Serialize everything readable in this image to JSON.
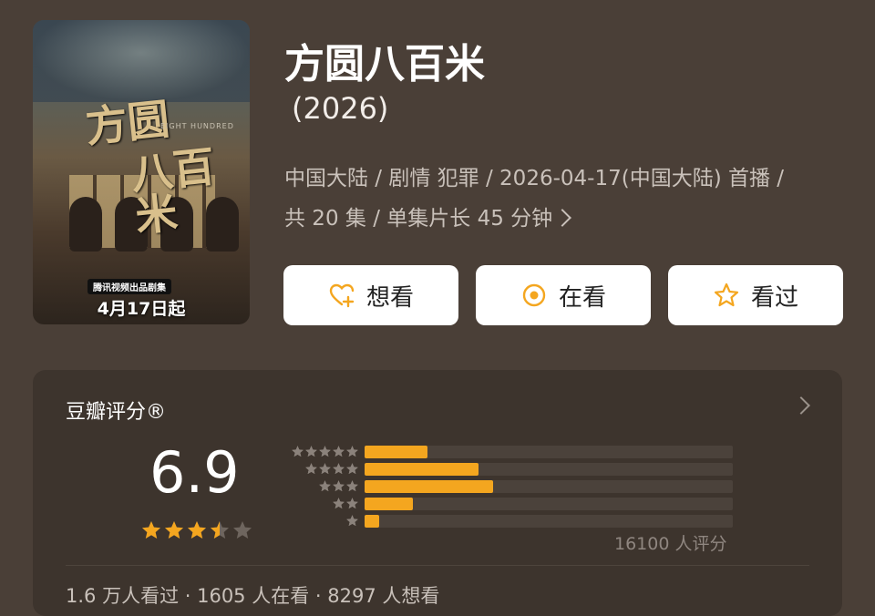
{
  "poster": {
    "calligraphy_line1": "方圆",
    "calligraphy_line2": "八百米",
    "english": "EIGHT HUNDRED",
    "badge": "腾讯视频出品剧集",
    "release": "4月17日起"
  },
  "title": "方圆八百米",
  "year": "(2026)",
  "meta": {
    "line1": "中国大陆 / 剧情 犯罪 / 2026-04-17(中国大陆) 首播 /",
    "line2": "共 20 集 / 单集片长 45 分钟"
  },
  "buttons": {
    "want": "想看",
    "watching": "在看",
    "watched": "看过"
  },
  "rating": {
    "section_title": "豆瓣评分®",
    "score": "6.9",
    "stars_value": 3.5,
    "stars_max": 5,
    "histogram": [
      {
        "stars": 5,
        "fraction": 0.17
      },
      {
        "stars": 4,
        "fraction": 0.31
      },
      {
        "stars": 3,
        "fraction": 0.35
      },
      {
        "stars": 2,
        "fraction": 0.13
      },
      {
        "stars": 1,
        "fraction": 0.04
      }
    ],
    "count": "16100 人评分"
  },
  "footer": "1.6 万人看过 · 1605 人在看 · 8297 人想看",
  "colors": {
    "accent": "#f4a61f",
    "background": "#4a3f37",
    "panel": "#3d342d"
  }
}
